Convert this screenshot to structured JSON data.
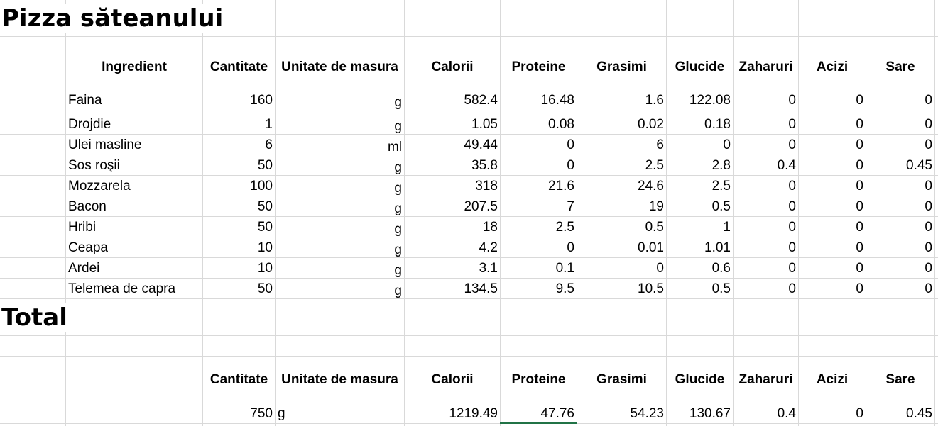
{
  "title": "Pizza săteanului",
  "headers": {
    "ingredient": "Ingredient",
    "cantitate": "Cantitate",
    "unitate": "Unitate de masura",
    "calorii": "Calorii",
    "proteine": "Proteine",
    "grasimi": "Grasimi",
    "glucide": "Glucide",
    "zaharuri": "Zaharuri",
    "acizi": "Acizi",
    "sare": "Sare"
  },
  "rows": [
    {
      "name": "Faina",
      "qty": "160",
      "unit": "g",
      "cal": "582.4",
      "prot": "16.48",
      "gras": "1.6",
      "gluc": "122.08",
      "zah": "0",
      "acizi": "0",
      "sare": "0"
    },
    {
      "name": "Drojdie",
      "qty": "1",
      "unit": "g",
      "cal": "1.05",
      "prot": "0.08",
      "gras": "0.02",
      "gluc": "0.18",
      "zah": "0",
      "acizi": "0",
      "sare": "0"
    },
    {
      "name": "Ulei masline",
      "qty": "6",
      "unit": "ml",
      "cal": "49.44",
      "prot": "0",
      "gras": "6",
      "gluc": "0",
      "zah": "0",
      "acizi": "0",
      "sare": "0"
    },
    {
      "name": "Sos roşii",
      "qty": "50",
      "unit": "g",
      "cal": "35.8",
      "prot": "0",
      "gras": "2.5",
      "gluc": "2.8",
      "zah": "0.4",
      "acizi": "0",
      "sare": "0.45"
    },
    {
      "name": "Mozzarela",
      "qty": "100",
      "unit": "g",
      "cal": "318",
      "prot": "21.6",
      "gras": "24.6",
      "gluc": "2.5",
      "zah": "0",
      "acizi": "0",
      "sare": "0"
    },
    {
      "name": "Bacon",
      "qty": "50",
      "unit": "g",
      "cal": "207.5",
      "prot": "7",
      "gras": "19",
      "gluc": "0.5",
      "zah": "0",
      "acizi": "0",
      "sare": "0"
    },
    {
      "name": "Hribi",
      "qty": "50",
      "unit": "g",
      "cal": "18",
      "prot": "2.5",
      "gras": "0.5",
      "gluc": "1",
      "zah": "0",
      "acizi": "0",
      "sare": "0"
    },
    {
      "name": "Ceapa",
      "qty": "10",
      "unit": "g",
      "cal": "4.2",
      "prot": "0",
      "gras": "0.01",
      "gluc": "1.01",
      "zah": "0",
      "acizi": "0",
      "sare": "0"
    },
    {
      "name": "Ardei",
      "qty": "10",
      "unit": "g",
      "cal": "3.1",
      "prot": "0.1",
      "gras": "0",
      "gluc": "0.6",
      "zah": "0",
      "acizi": "0",
      "sare": "0"
    },
    {
      "name": "Telemea de capra",
      "qty": "50",
      "unit": "g",
      "cal": "134.5",
      "prot": "9.5",
      "gras": "10.5",
      "gluc": "0.5",
      "zah": "0",
      "acizi": "0",
      "sare": "0"
    }
  ],
  "total": {
    "title": "Total",
    "qty": "750",
    "unit": "g",
    "cal": "1219.49",
    "prot": "47.76",
    "gras": "54.23",
    "gluc": "130.67",
    "zah": "0.4",
    "acizi": "0",
    "sare": "0.45"
  }
}
